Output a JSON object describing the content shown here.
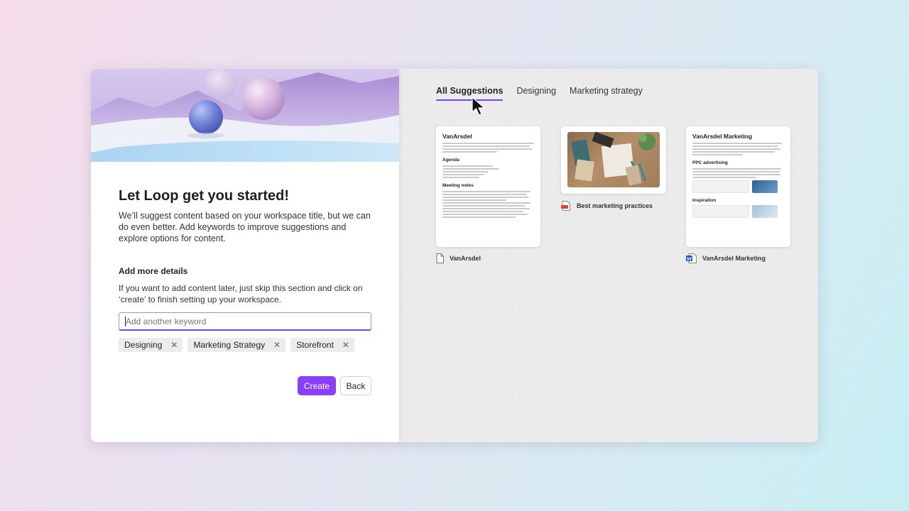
{
  "panel": {
    "title": "Let Loop get you started!",
    "description": "We’ll suggest content based on your workspace title, but we can do even better. Add keywords to improve suggestions and explore options for content.",
    "details_title": "Add more details",
    "details_description": "If you want to add content later, just skip this section and click on ‘create’ to finish setting up your workspace.",
    "keyword_input": {
      "placeholder": "Add another keyword",
      "value": ""
    },
    "chips": [
      {
        "label": "Designing"
      },
      {
        "label": "Marketing Strategy"
      },
      {
        "label": "Storefront"
      }
    ],
    "chip_remove_glyph": "✕",
    "create_label": "Create",
    "back_label": "Back"
  },
  "suggestions": {
    "tabs": [
      {
        "label": "All Suggestions",
        "active": true
      },
      {
        "label": "Designing",
        "active": false
      },
      {
        "label": "Marketing strategy",
        "active": false
      }
    ],
    "cards": [
      {
        "title": "VanArsdel",
        "sections": [
          "Agenda",
          "Meeting notes"
        ],
        "file_name": "VanArsdel",
        "file_icon": "page-icon"
      },
      {
        "file_name": "Best marketing practices",
        "file_icon": "pdf-icon",
        "image": "desk-photo"
      },
      {
        "title": "VanArsdel Marketing",
        "sections": [
          "PPC advertising",
          "Inspiration"
        ],
        "file_name": "VanArsdel Marketing",
        "file_icon": "word-icon"
      }
    ]
  },
  "colors": {
    "accent": "#8a3ffc",
    "tab_underline": "#7a3ff0"
  }
}
